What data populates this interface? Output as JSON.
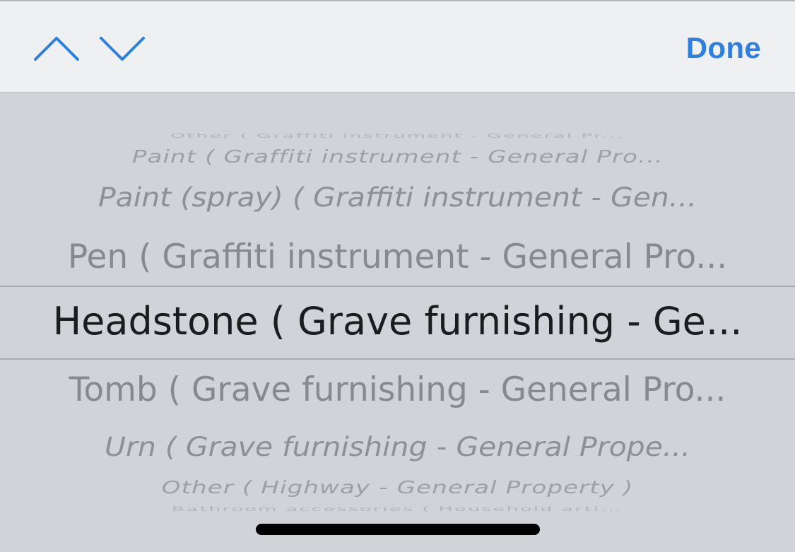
{
  "toolbar": {
    "previous_icon": "chevron-up-icon",
    "next_icon": "chevron-down-icon",
    "done_label": "Done",
    "accent_color": "#2f7fde"
  },
  "picker": {
    "selected_index": 4,
    "items": [
      "Other ( Graffiti instrument - General Pr...",
      "Paint ( Graffiti instrument - General Pro...",
      "Paint (spray) ( Graffiti instrument - Gen...",
      "Pen ( Graffiti instrument - General Pro...",
      "Headstone ( Grave furnishing - Ge...",
      "Tomb ( Grave furnishing - General Pro...",
      "Urn ( Grave furnishing - General Prope...",
      "Other ( Highway - General Property )",
      "Bathroom accessories ( Household arti..."
    ]
  }
}
